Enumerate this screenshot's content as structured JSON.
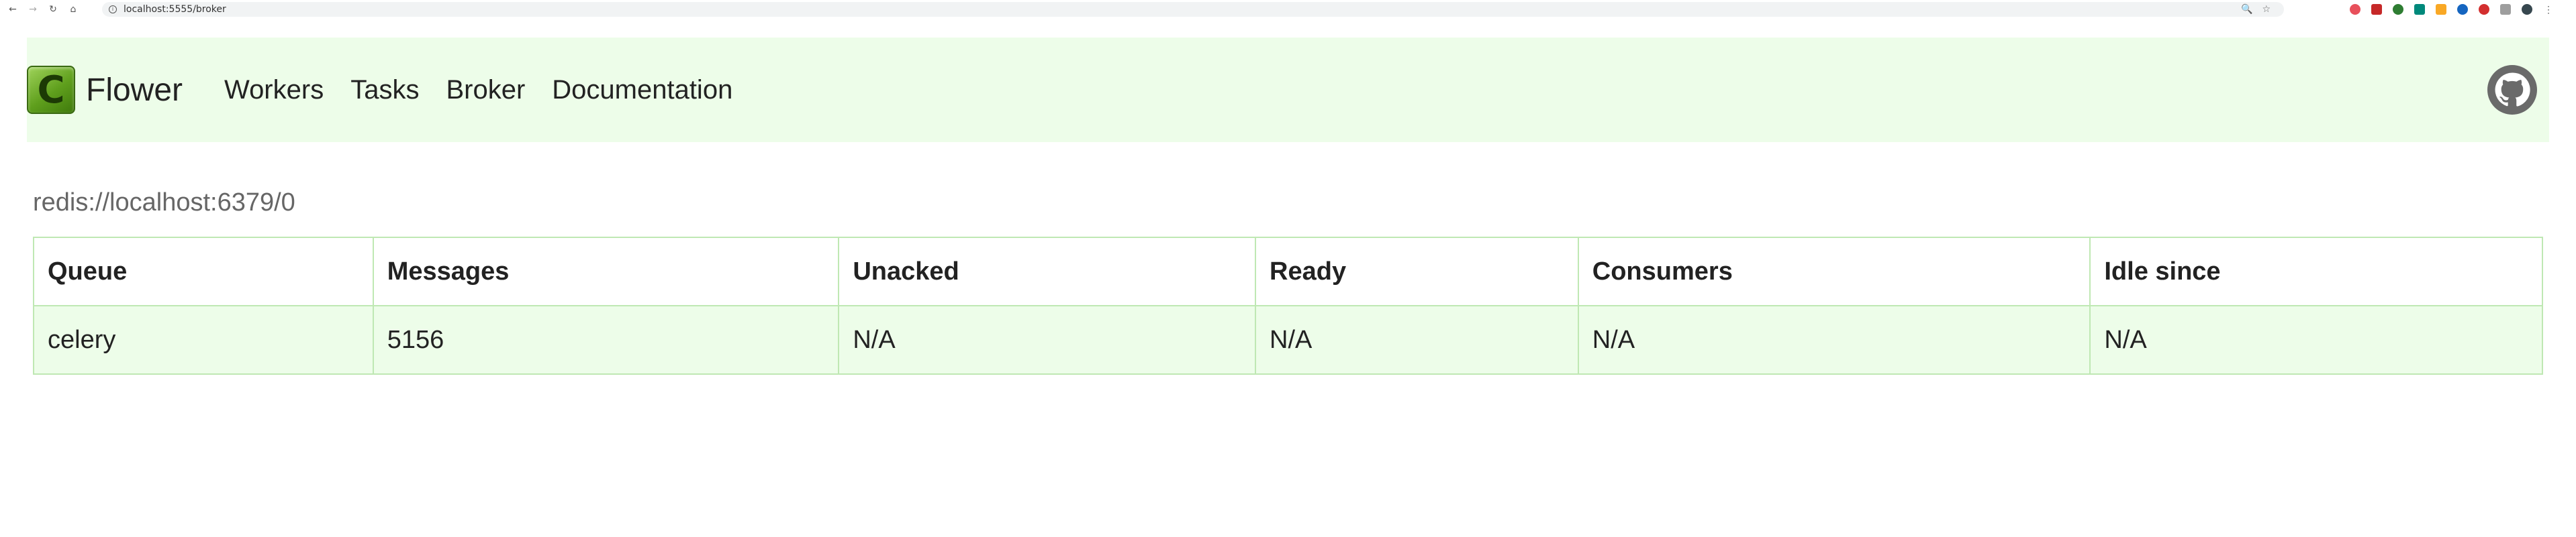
{
  "browser": {
    "url": "localhost:5555/broker",
    "back_icon": "back-arrow-icon",
    "forward_icon": "forward-arrow-icon",
    "reload_icon": "reload-icon",
    "home_icon": "home-icon"
  },
  "navbar": {
    "brand_letter": "C",
    "brand_name": "Flower",
    "links": [
      "Workers",
      "Tasks",
      "Broker",
      "Documentation"
    ],
    "github_icon": "github-icon",
    "background": "#edfde9"
  },
  "broker": {
    "url": "redis://localhost:6379/0"
  },
  "table": {
    "headers": [
      "Queue",
      "Messages",
      "Unacked",
      "Ready",
      "Consumers",
      "Idle since"
    ],
    "rows": [
      [
        "celery",
        "5156",
        "N/A",
        "N/A",
        "N/A",
        "N/A"
      ]
    ],
    "border_color": "#bfe8b3",
    "row_color": "#edfde9"
  }
}
